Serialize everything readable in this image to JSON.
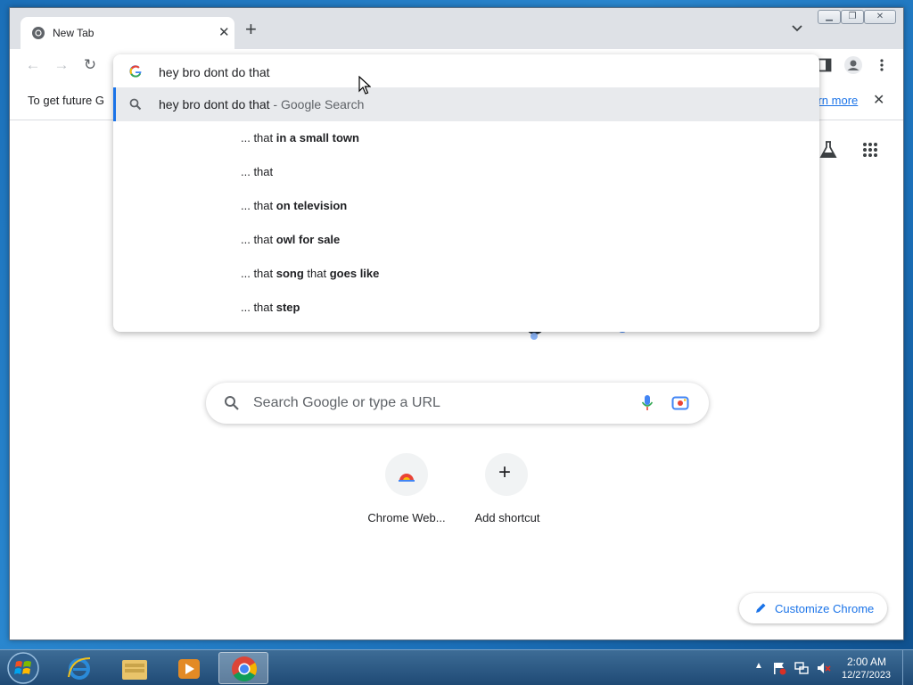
{
  "browser": {
    "tab_title": "New Tab",
    "infobar_text": "To get future G",
    "infobar_link": "earn more"
  },
  "omnibox": {
    "input_value": "hey bro dont do that",
    "suggestions": [
      {
        "prefix": "hey bro dont do that",
        "suffix": " - Google Search"
      },
      {
        "lead": "... that ",
        "bold": "in a small town",
        "tail": "",
        "bold2": ""
      },
      {
        "lead": "... that",
        "bold": "",
        "tail": "",
        "bold2": ""
      },
      {
        "lead": "... that ",
        "bold": "on television",
        "tail": "",
        "bold2": ""
      },
      {
        "lead": "... that ",
        "bold": "owl for sale",
        "tail": "",
        "bold2": ""
      },
      {
        "lead": "... that ",
        "bold": "song",
        "tail": " that ",
        "bold2": "goes like"
      },
      {
        "lead": "... that ",
        "bold": "step",
        "tail": "",
        "bold2": ""
      }
    ]
  },
  "ntp": {
    "search_placeholder": "Search Google or type a URL",
    "shortcuts": [
      {
        "label": "Chrome Web..."
      },
      {
        "label": "Add shortcut"
      }
    ],
    "customize_label": "Customize Chrome"
  },
  "taskbar": {
    "time": "2:00 AM",
    "date": "12/27/2023"
  },
  "colors": {
    "accent": "#1a73e8",
    "tabstrip": "#dee1e6"
  }
}
